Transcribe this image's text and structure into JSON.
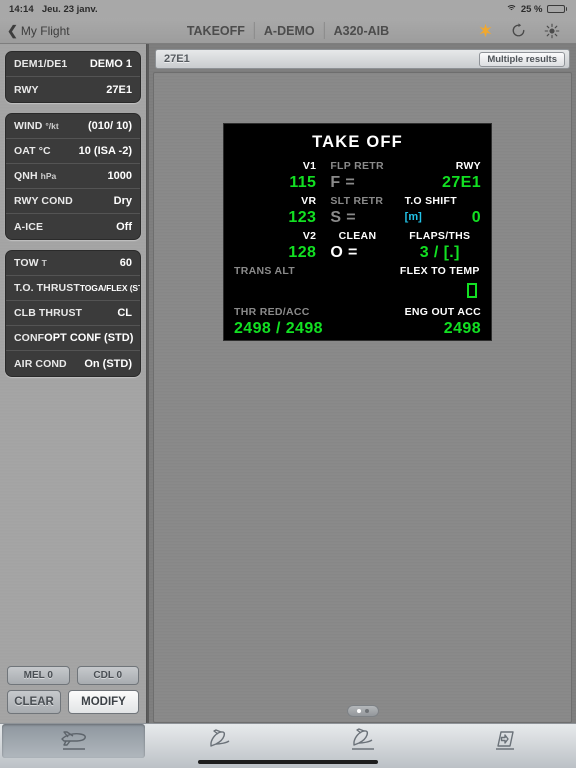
{
  "status_bar": {
    "time": "14:14",
    "date": "Jeu. 23 janv.",
    "battery_percent": "25 %",
    "wifi_icon": "wifi-icon",
    "battery_icon": "battery-icon",
    "battery_level": 25
  },
  "nav": {
    "back_label": "My Flight",
    "back_chevron": "chevron-left-icon",
    "crumbs": [
      "TAKEOFF",
      "A-DEMO",
      "A320-AIB"
    ],
    "icons": [
      "sparkle-icon",
      "refresh-icon",
      "brightness-icon"
    ],
    "accent": "#f0a830"
  },
  "sidebar": {
    "groups": [
      {
        "rows": [
          {
            "label": "DEM1/DE1",
            "unit": "",
            "value": "DEMO 1",
            "small": false
          },
          {
            "label": "RWY",
            "unit": "",
            "value": "27E1",
            "small": false
          }
        ]
      },
      {
        "rows": [
          {
            "label": "WIND",
            "unit": "°/kt",
            "value": "(010/ 10)",
            "small": false
          },
          {
            "label": "OAT °C",
            "unit": "",
            "value": "10 (ISA -2)",
            "small": false
          },
          {
            "label": "QNH",
            "unit": "hPa",
            "value": "1000",
            "small": false
          },
          {
            "label": "RWY COND",
            "unit": "",
            "value": "Dry",
            "small": false
          },
          {
            "label": "A-ICE",
            "unit": "",
            "value": "Off",
            "small": false
          }
        ]
      },
      {
        "rows": [
          {
            "label": "TOW",
            "unit": "T",
            "value": "60",
            "small": false
          },
          {
            "label": "T.O. THRUST",
            "unit": "",
            "value": "TOGA/FLEX (STD) °C",
            "small": true
          },
          {
            "label": "CLB THRUST",
            "unit": "",
            "value": "CL",
            "small": false
          },
          {
            "label": "CONF",
            "unit": "",
            "value": "OPT CONF (STD)",
            "small": false
          },
          {
            "label": "AIR COND",
            "unit": "",
            "value": "On (STD)",
            "small": false
          }
        ]
      }
    ],
    "buttons": {
      "mel": "MEL 0",
      "cdl": "CDL 0",
      "clear": "CLEAR",
      "modify": "MODIFY"
    }
  },
  "main": {
    "header_title": "27E1",
    "header_button": "Multiple results",
    "mcdu": {
      "title": "TAKE OFF",
      "rows": [
        {
          "left_label": "V1",
          "left_value": "115",
          "center_label": "FLP RETR",
          "center_value": "F =",
          "right_label": "RWY",
          "right_value": "27E1"
        },
        {
          "left_label": "VR",
          "left_value": "123",
          "center_label": "SLT RETR",
          "center_value": "S =",
          "right_label": "T.O SHIFT",
          "right_unit": "[m]",
          "right_value": "0"
        },
        {
          "left_label": "V2",
          "left_value": "128",
          "center_label": "CLEAN",
          "center_value": "O =",
          "right_label": "FLAPS/THS",
          "right_value": "3 / [.]"
        },
        {
          "left_label": "TRANS ALT",
          "left_value": "",
          "right_label": "FLEX TO TEMP",
          "right_value": ""
        },
        {
          "left_label": "THR RED/ACC",
          "left_value": "2498 / 2498",
          "right_label": "ENG OUT ACC",
          "right_value": "2498"
        }
      ],
      "colors": {
        "value_green": "#12e022",
        "label_white": "#ffffff",
        "label_dim": "#8a8a8a",
        "unit_blue": "#22c3e8",
        "screen_bg": "#000000"
      }
    },
    "page_dots": {
      "count": 2,
      "active": 1
    }
  },
  "tabbar": {
    "tabs": [
      {
        "name": "takeoff",
        "icon": "airplane-takeoff-icon",
        "active": true
      },
      {
        "name": "climb",
        "icon": "airplane-climb-icon",
        "active": false
      },
      {
        "name": "landing",
        "icon": "airplane-landing-icon",
        "active": false
      },
      {
        "name": "documents",
        "icon": "document-arrow-icon",
        "active": false
      }
    ]
  }
}
